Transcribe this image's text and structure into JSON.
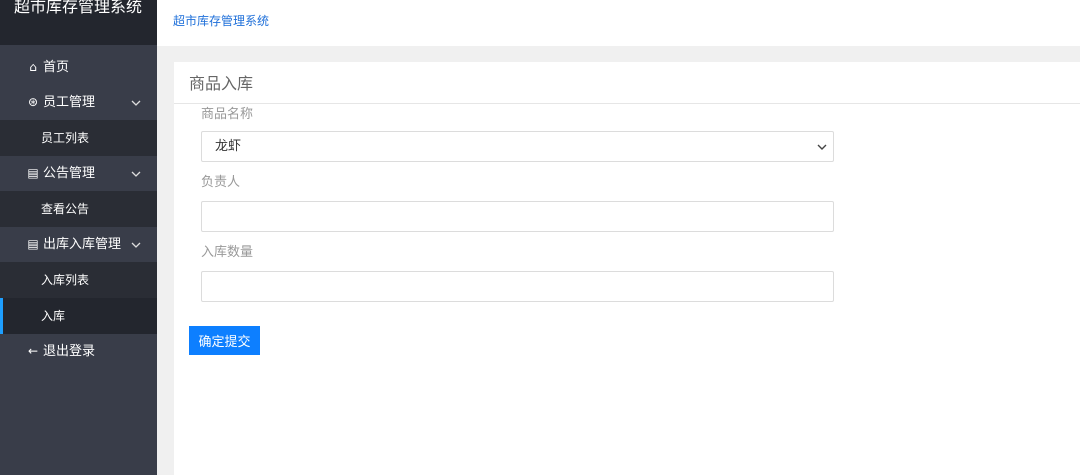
{
  "app": {
    "title": "超市库存管理系统"
  },
  "header": {
    "brand_link": "超市库存管理系统"
  },
  "sidebar": {
    "home": "首页",
    "employee_group": "员工管理",
    "employee_list": "员工列表",
    "notice_group": "公告管理",
    "notice_view": "查看公告",
    "stock_group": "出库入库管理",
    "stock_list": "入库列表",
    "stock_in": "入库",
    "logout": "退出登录"
  },
  "panel": {
    "title": "商品入库"
  },
  "form": {
    "product_label": "商品名称",
    "product_value": "龙虾",
    "manager_label": "负责人",
    "manager_value": "",
    "quantity_label": "入库数量",
    "quantity_value": "",
    "submit_label": "确定提交"
  },
  "colors": {
    "sidebar_bg": "#393d49",
    "accent": "#0d7fff",
    "link": "#1e6fd9",
    "active_marker": "#1e9fff"
  }
}
